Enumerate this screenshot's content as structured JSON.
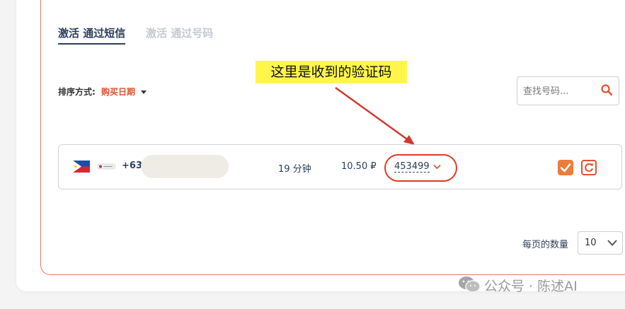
{
  "tabs": [
    {
      "label": "激活 通过短信",
      "active": true
    },
    {
      "label": "激活 通过号码",
      "active": false
    }
  ],
  "annotation": {
    "text": "这里是收到的验证码"
  },
  "sort": {
    "label": "排序方式:",
    "value": "购买日期"
  },
  "search": {
    "placeholder": "查找号码..."
  },
  "row": {
    "country": "Philippines",
    "prefix": "+63",
    "time": "19 分钟",
    "price": "10.50 ₽",
    "code": "453499"
  },
  "pagination": {
    "label": "每页的数量",
    "value": "10"
  },
  "watermark": {
    "text": "公众号 · 陈述AI"
  },
  "colors": {
    "accent": "#e0512e",
    "navy": "#2d3f5c",
    "highlight": "#fef64a",
    "annotation_red": "#e03a2a",
    "checkbox": "#ec7c3c"
  }
}
